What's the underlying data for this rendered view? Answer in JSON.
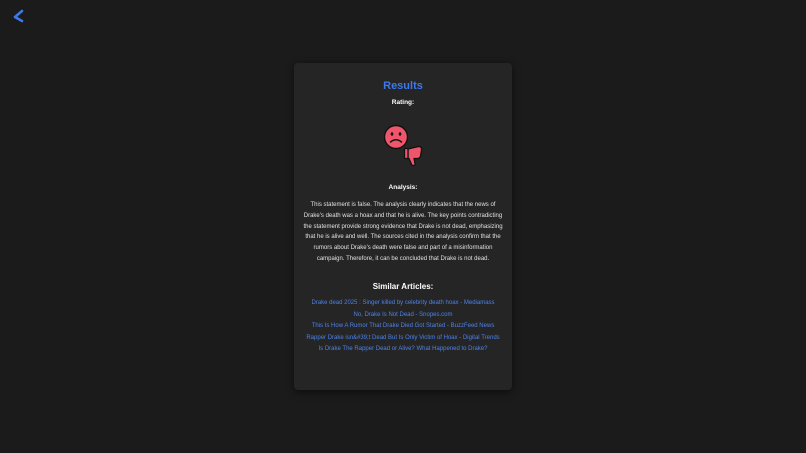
{
  "nav": {
    "back_icon": "chevron-left-icon",
    "back_color": "#3c78e8"
  },
  "results": {
    "title": "Results",
    "rating_label": "Rating:",
    "rating_icon": "sad-face-thumbs-down-icon",
    "analysis_label": "Analysis:",
    "analysis_text": "This statement is false. The analysis clearly indicates that the news of Drake's death was a hoax and that he is alive. The key points contradicting the statement provide strong evidence that Drake is not dead, emphasizing that he is alive and well. The sources cited in the analysis confirm that the rumors about Drake's death were false and part of a misinformation campaign. Therefore, it can be concluded that Drake is not dead."
  },
  "similar": {
    "heading": "Similar Articles:",
    "articles": [
      {
        "title": "Drake dead 2025 : Singer killed by celebrity death hoax - Mediamass"
      },
      {
        "title": "No, Drake Is Not Dead - Snopes.com"
      },
      {
        "title": "This Is How A Rumor That Drake Died Got Started - BuzzFeed News"
      },
      {
        "title": "Rapper Drake isn&#39;t Dead But Is Only Victim of Hoax - Digital Trends"
      },
      {
        "title": "Is Drake The Rapper Dead or Alive? What Happened to Drake?"
      }
    ]
  },
  "colors": {
    "background": "#1b1b1c",
    "card": "#252526",
    "accent": "#3c78e8",
    "link": "#4d82e8",
    "icon_red": "#f0566b"
  }
}
